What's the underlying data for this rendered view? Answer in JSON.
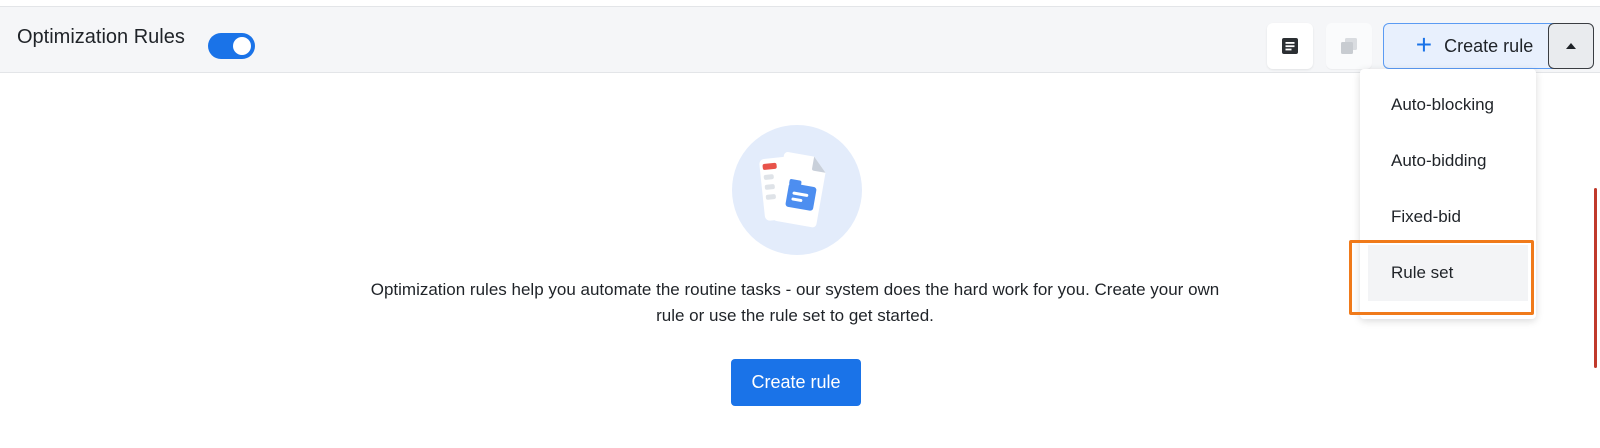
{
  "header": {
    "title": "Optimization Rules",
    "toggle_on": true,
    "create_rule_label": "Create rule",
    "icons": {
      "notes": "notes-icon",
      "duplicate": "duplicate-icon",
      "add": "plus-icon",
      "caret": "caret-up-icon"
    }
  },
  "dropdown": {
    "items": [
      {
        "label": "Auto-blocking"
      },
      {
        "label": "Auto-bidding"
      },
      {
        "label": "Fixed-bid"
      },
      {
        "label": "Rule set"
      }
    ],
    "active_index": 3
  },
  "empty_state": {
    "illustration": "documents-folder-illustration",
    "message": "Optimization rules help you automate the routine tasks - our system does the hard work for you. Create your own rule or use the rule set to get started.",
    "cta_label": "Create rule"
  },
  "colors": {
    "primary": "#1a73e8",
    "highlight": "#f07a1a",
    "header_bg": "#f5f6f8"
  }
}
